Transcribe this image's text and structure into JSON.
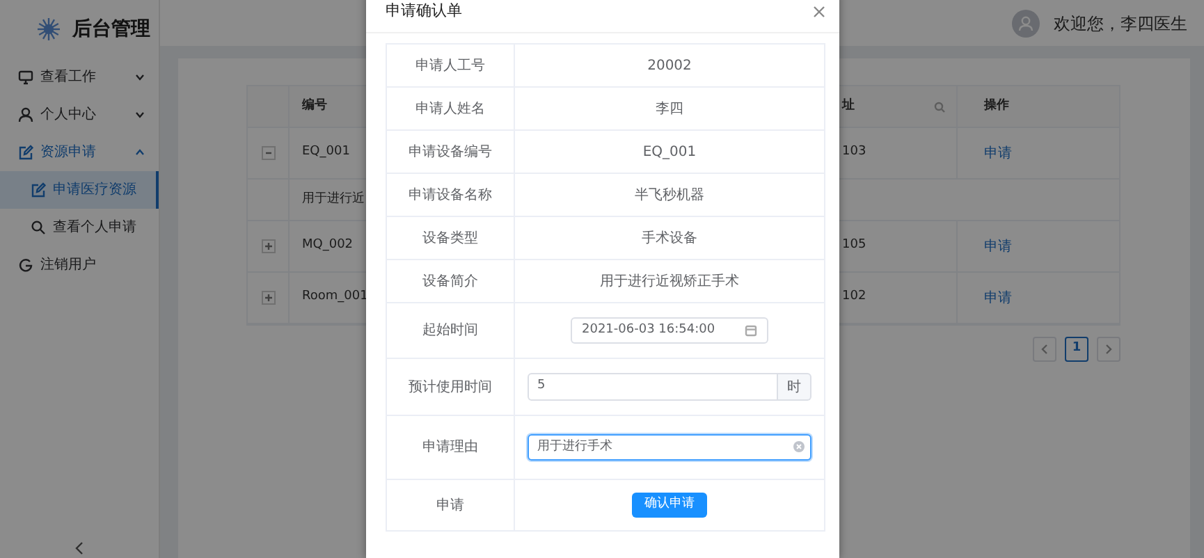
{
  "sidebar": {
    "logo": "后台管理",
    "items": [
      {
        "label": "查看工作",
        "expanded": false,
        "selected": false
      },
      {
        "label": "个人中心",
        "expanded": false,
        "selected": false
      },
      {
        "label": "资源申请",
        "expanded": true,
        "selected": true,
        "children": [
          {
            "label": "申请医疗资源",
            "selected": true
          },
          {
            "label": "查看个人申请",
            "selected": false
          }
        ]
      },
      {
        "label": "注销用户",
        "selected": false
      }
    ]
  },
  "header": {
    "welcome": "欢迎您，李四医生"
  },
  "table": {
    "columns": [
      "编号",
      "址",
      "操作"
    ],
    "rows": [
      {
        "expanded": true,
        "cells": [
          "EQ_001",
          "103",
          "申请"
        ],
        "detail": "用于进行近"
      },
      {
        "expanded": false,
        "cells": [
          "MQ_002",
          "105",
          "申请"
        ]
      },
      {
        "expanded": false,
        "cells": [
          "Room_001",
          "102",
          "申请"
        ]
      }
    ]
  },
  "pagination": {
    "pages": [
      {
        "label": "1",
        "selected": true
      }
    ]
  },
  "modal": {
    "title": "申请确认单",
    "fields": [
      {
        "kind": "text",
        "label": "申请人工号",
        "value": "20002"
      },
      {
        "kind": "text",
        "label": "申请人姓名",
        "value": "李四"
      },
      {
        "kind": "text",
        "label": "申请设备编号",
        "value": "EQ_001"
      },
      {
        "kind": "text",
        "label": "申请设备名称",
        "value": "半飞秒机器"
      },
      {
        "kind": "text",
        "label": "设备类型",
        "value": "手术设备"
      },
      {
        "kind": "text",
        "label": "设备简介",
        "value": "用于进行近视矫正手术"
      },
      {
        "kind": "date",
        "label": "起始时间",
        "value": "2021-06-03 16:54:00"
      },
      {
        "kind": "number",
        "label": "预计使用时间",
        "value": "5",
        "suffix": "时"
      },
      {
        "kind": "textarea",
        "label": "申请理由",
        "value": "用于进行手术",
        "focused": true
      },
      {
        "kind": "button",
        "label": "申请",
        "button": "确认申请"
      }
    ]
  }
}
